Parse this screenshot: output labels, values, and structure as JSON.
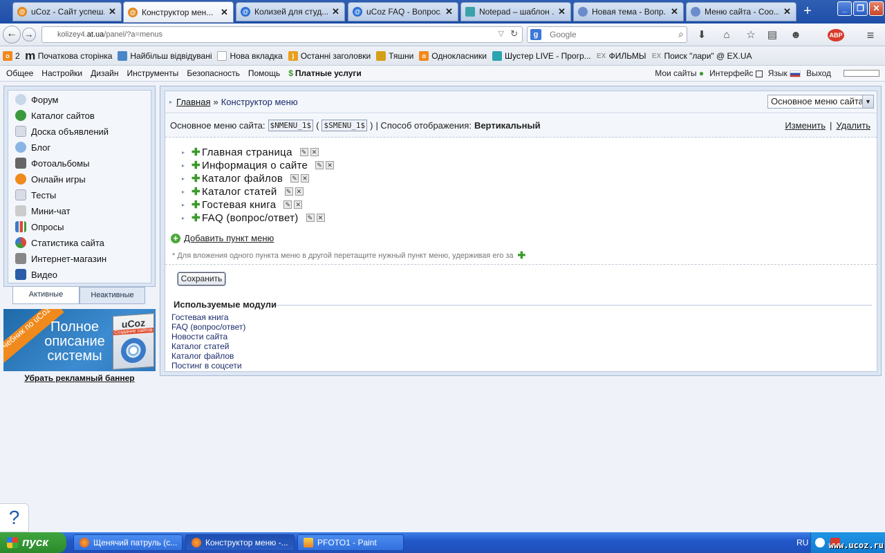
{
  "browser": {
    "tabs": [
      {
        "label": "uCoz - Сайт успеш...",
        "icon": "ucoz-icon",
        "color": "#e58a1f",
        "active": false
      },
      {
        "label": "Конструктор мен...",
        "icon": "ucoz-icon",
        "color": "#e58a1f",
        "active": true
      },
      {
        "label": "Колизей для студ...",
        "icon": "ucoz-icon",
        "color": "#2a6fd6",
        "active": false
      },
      {
        "label": "uCoz FAQ - Вопрос...",
        "icon": "ucoz-icon",
        "color": "#2a6fd6",
        "active": false
      },
      {
        "label": "Notepad – шаблон ...",
        "icon": "notepad-icon",
        "color": "#3aa2a8",
        "active": false
      },
      {
        "label": "Новая тема - Вопр...",
        "icon": "forum-icon",
        "color": "#6a8ccb",
        "active": false
      },
      {
        "label": "Меню сайта - Соо...",
        "icon": "forum-icon",
        "color": "#6a8ccb",
        "active": false
      }
    ],
    "url_host": "kolizey4.",
    "url_domain": "at.ua",
    "url_path": "/panel/?a=menus",
    "search_placeholder": "Google",
    "bookmarks": [
      {
        "label": "2",
        "icon": "odnoklassniki-icon",
        "color": "#f08a1c"
      },
      {
        "label": "Початкова сторінка",
        "icon": "m-icon",
        "color": "#333333"
      },
      {
        "label": "Найбільш відвідувані",
        "icon": "bookmark-icon",
        "color": "#4a86c8"
      },
      {
        "label": "Нова вкладка",
        "icon": "page-icon",
        "color": "#bbbbbb"
      },
      {
        "label": "Останні заголовки",
        "icon": "rss-icon",
        "color": "#e8a020"
      },
      {
        "label": "Тяшни",
        "icon": "folder-icon",
        "color": "#d4a017"
      },
      {
        "label": "Однокласники",
        "icon": "odnoklassniki-icon",
        "color": "#f08a1c"
      },
      {
        "label": "Шустер LIVE - Прогр...",
        "icon": "shuster-icon",
        "color": "#2aa4b0"
      },
      {
        "label": "ФИЛЬМЫ",
        "icon": "ex-icon",
        "color": "#999999"
      },
      {
        "label": "Поиск \"лари\" @ EX.UA",
        "icon": "ex-icon",
        "color": "#999999"
      }
    ]
  },
  "ucoz_menu": {
    "items": [
      "Общее",
      "Настройки",
      "Дизайн",
      "Инструменты",
      "Безопасность",
      "Помощь"
    ],
    "paid": "Платные услуги",
    "right": [
      "Мои сайты",
      "Интерфейс",
      "Язык",
      "Выход"
    ]
  },
  "sidebar": {
    "items": [
      {
        "label": "Форум",
        "icon": "forum-icon",
        "color": "#c8d6ea"
      },
      {
        "label": "Каталог сайтов",
        "icon": "globe-icon",
        "color": "#3c9a3c"
      },
      {
        "label": "Доска объявлений",
        "icon": "board-icon",
        "color": "#d8dce6"
      },
      {
        "label": "Блог",
        "icon": "blog-icon",
        "color": "#8ab4e6"
      },
      {
        "label": "Фотоальбомы",
        "icon": "camera-icon",
        "color": "#666666"
      },
      {
        "label": "Онлайн игры",
        "icon": "games-icon",
        "color": "#f08a1c"
      },
      {
        "label": "Тесты",
        "icon": "tests-icon",
        "color": "#d8dce6"
      },
      {
        "label": "Мини-чат",
        "icon": "chat-icon",
        "color": "#cccccc"
      },
      {
        "label": "Опросы",
        "icon": "polls-icon",
        "color": "#3c7ac8"
      },
      {
        "label": "Статистика сайта",
        "icon": "stats-icon",
        "color": "#d84a3a"
      },
      {
        "label": "Интернет-магазин",
        "icon": "shop-icon",
        "color": "#888888"
      },
      {
        "label": "Видео",
        "icon": "video-icon",
        "color": "#2a5ca8"
      }
    ],
    "tab_active": "Активные",
    "tab_inactive": "Неактивные"
  },
  "banner": {
    "ribbon": "Учебник по uCoz",
    "text": "Полное описание системы",
    "box_title": "uCoz",
    "box_sub": "Создание сайтов",
    "remove": "Убрать рекламный баннер"
  },
  "main": {
    "breadcrumb_home": "Главная",
    "breadcrumb_sep": "»",
    "breadcrumb_current": "Конструктор меню",
    "menu_select": "Основное меню сайта",
    "info_label": "Основное меню сайта:",
    "code1": "$NMENU_1$",
    "code2": "$SMENU_1$",
    "display_label": "| Способ отображения:",
    "display_value": "Вертикальный",
    "edit_link": "Изменить",
    "delete_link": "Удалить",
    "menu_items": [
      "Главная страница",
      "Информация о сайте",
      "Каталог файлов",
      "Каталог статей",
      "Гостевая книга",
      "FAQ (вопрос/ответ)"
    ],
    "add_item": "Добавить пункт меню",
    "hint": "* Для вложения одного пункта меню в другой перетащите нужный пункт меню, удерживая его за",
    "save": "Сохранить",
    "modules_title": "Используемые модули",
    "modules": [
      "Гостевая книга",
      "FAQ (вопрос/ответ)",
      "Новости сайта",
      "Каталог статей",
      "Каталог файлов",
      "Постинг в соцсети"
    ]
  },
  "taskbar": {
    "start": "пуск",
    "tasks": [
      {
        "label": "Щенячий патруль (с...",
        "icon": "firefox-icon"
      },
      {
        "label": "Конструктор меню -...",
        "icon": "firefox-icon"
      },
      {
        "label": "PFOTO1 - Paint",
        "icon": "paint-icon"
      }
    ],
    "lang": "RU",
    "watermark": "www.ucoz.ru"
  },
  "help_symbol": "?"
}
